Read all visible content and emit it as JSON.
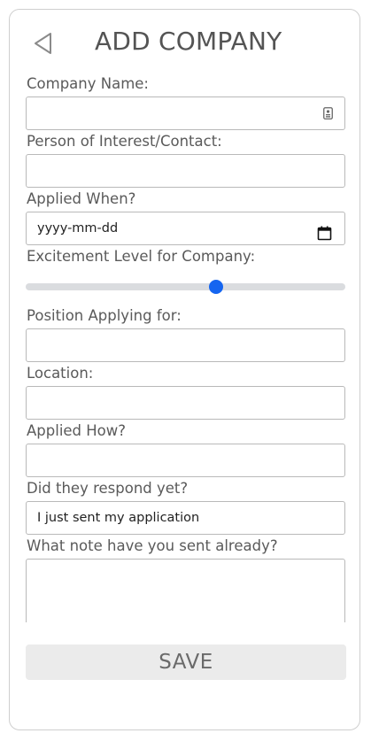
{
  "header": {
    "title": "ADD COMPANY",
    "back_icon": "back-triangle-icon"
  },
  "form": {
    "company_name": {
      "label": "Company Name:",
      "value": "",
      "icon": "contact-card-icon"
    },
    "contact": {
      "label": "Person of Interest/Contact:",
      "value": ""
    },
    "applied_when": {
      "label": "Applied When?",
      "value": "yyyy-mm-dd",
      "icon": "calendar-icon"
    },
    "excitement": {
      "label": "Excitement Level for Company:",
      "value_fraction": 0.6,
      "accent_color": "#1565f0"
    },
    "position": {
      "label": "Position Applying for:",
      "value": ""
    },
    "location": {
      "label": "Location:",
      "value": ""
    },
    "applied_how": {
      "label": "Applied How?",
      "value": ""
    },
    "response": {
      "label": "Did they respond yet?",
      "value": "I just sent my application"
    },
    "note": {
      "label": "What note have you sent already?",
      "value": ""
    }
  },
  "actions": {
    "save_label": "SAVE"
  }
}
